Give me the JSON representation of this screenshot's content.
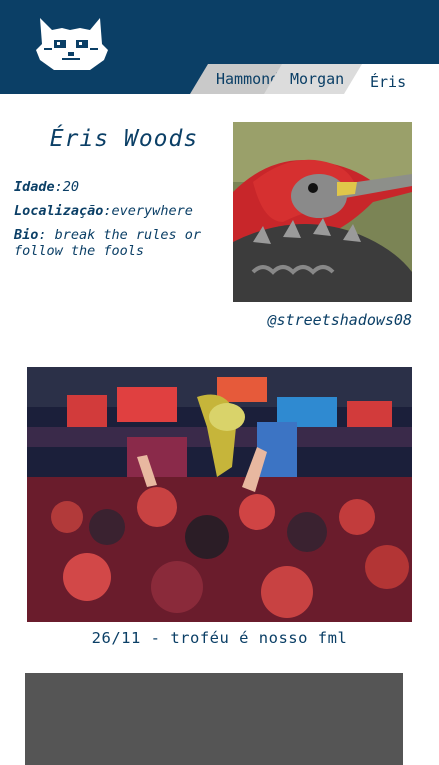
{
  "tabs": [
    {
      "label": "Hammond"
    },
    {
      "label": "Morgan"
    },
    {
      "label": "Éris"
    }
  ],
  "profile": {
    "name": "Éris Woods",
    "age_label": "Idade",
    "age_value": "20",
    "location_label": "Localização",
    "location_value": "everywhere",
    "bio_label": "Bio",
    "bio_value": "break the rules or follow the fools",
    "handle": "@streetshadows08"
  },
  "post": {
    "caption": "26/11 - troféu é nosso fml"
  },
  "colors": {
    "header": "#0b3f66",
    "text": "#0b3f66",
    "gray_block": "#555555"
  }
}
